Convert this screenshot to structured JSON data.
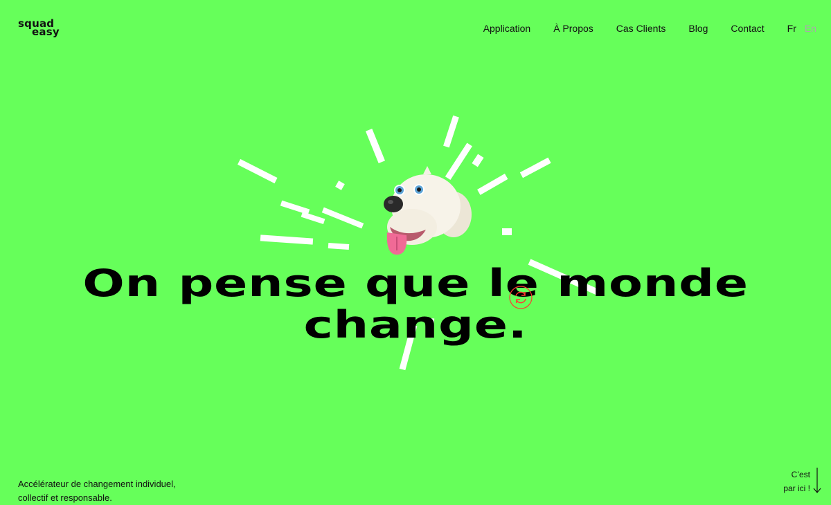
{
  "brand": {
    "line1": "squad",
    "line2": "easy"
  },
  "nav": {
    "items": [
      {
        "label": "Application"
      },
      {
        "label": "À Propos"
      },
      {
        "label": "Cas Clients"
      },
      {
        "label": "Blog"
      },
      {
        "label": "Contact"
      }
    ],
    "lang": {
      "fr": "Fr",
      "en": "En"
    }
  },
  "hero": {
    "headline_line1": "On pense que le monde",
    "headline_line2": "change.",
    "mascot_icon": "dog-mascot-icon",
    "refresh_icon": "refresh-icon"
  },
  "footer": {
    "tagline": "Accélérateur de changement individuel, collectif et responsable.",
    "scroll_cta_line1": "C’est",
    "scroll_cta_line2": "par ici !",
    "scroll_icon": "arrow-down-icon"
  },
  "colors": {
    "background": "#66ff5a",
    "text": "#111111",
    "accent": "#ff3b30",
    "burst": "#ffffff"
  }
}
